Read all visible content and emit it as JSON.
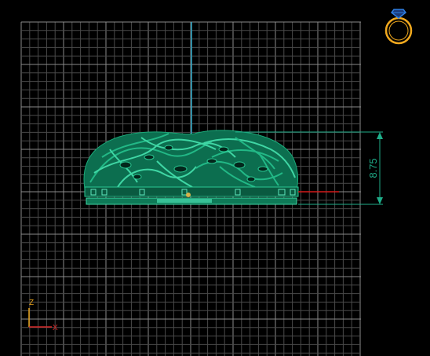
{
  "viewport": {
    "background": "#000000",
    "grid_color": "#6f6f6f",
    "vertical_axis_color": "#2aa7c7",
    "horizontal_axis_color": "#d21a1a"
  },
  "model": {
    "color": "#0f8a62",
    "highlight": "#3fd6a4",
    "dimension": {
      "value": "8.75",
      "color": "#1fae8a"
    }
  },
  "view_cube": {
    "icon": "ring-icon",
    "color": "#f0a81e",
    "gem_color": "#2e7de0"
  },
  "axis_gizmo": {
    "z_label": "Z",
    "x_label": "X",
    "z_color": "#e6a21c",
    "x_color": "#d82a2a"
  }
}
